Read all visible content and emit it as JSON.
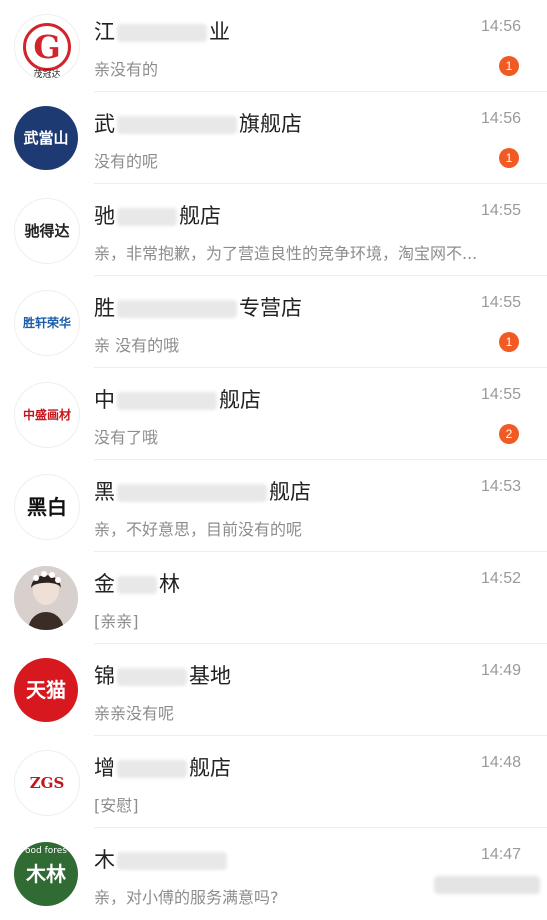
{
  "conversations": [
    {
      "title_start": "江",
      "title_end": "业",
      "subtitle": "亲没有的",
      "time": "14:56",
      "unread": "1",
      "avatar": {
        "type": "logo",
        "text": "G",
        "caption": "茂冠达",
        "bg": "#ffffff",
        "color": "#d1252b"
      }
    },
    {
      "title_start": "武",
      "title_end": "旗舰店",
      "subtitle": "没有的呢",
      "time": "14:56",
      "unread": "1",
      "avatar": {
        "type": "logo",
        "text": "武當山",
        "caption": "",
        "bg": "#1d3a73",
        "color": "#ffffff"
      }
    },
    {
      "title_start": "驰",
      "title_end": "舰店",
      "subtitle": "亲，非常抱歉，为了营造良性的竞争环境，淘宝网不...",
      "time": "14:55",
      "unread": "",
      "avatar": {
        "type": "logo",
        "text": "驰得达",
        "caption": "",
        "bg": "#ffffff",
        "color": "#222222"
      }
    },
    {
      "title_start": "胜",
      "title_end": "专营店",
      "subtitle": "亲 没有的哦",
      "time": "14:55",
      "unread": "1",
      "avatar": {
        "type": "logo",
        "text": "胜轩荣华",
        "caption": "",
        "bg": "#ffffff",
        "color": "#1b5ca8"
      }
    },
    {
      "title_start": "中",
      "title_end": "舰店",
      "subtitle": "没有了哦",
      "time": "14:55",
      "unread": "2",
      "avatar": {
        "type": "logo",
        "text": "中盛画材",
        "caption": "",
        "bg": "#ffffff",
        "color": "#c4161c"
      }
    },
    {
      "title_start": "黑",
      "title_end": "舰店",
      "subtitle": "亲，不好意思，目前没有的呢",
      "time": "14:53",
      "unread": "",
      "avatar": {
        "type": "logo",
        "text": "黑白",
        "caption": "",
        "bg": "#ffffff",
        "color": "#111111"
      }
    },
    {
      "title_start": "金",
      "title_end": "林",
      "subtitle": "[亲亲]",
      "time": "14:52",
      "unread": "",
      "avatar": {
        "type": "photo",
        "text": "",
        "caption": "",
        "bg": "#d9d2cf",
        "color": "#4a3a36"
      }
    },
    {
      "title_start": "锦",
      "title_end": "基地",
      "subtitle": "亲亲没有呢",
      "time": "14:49",
      "unread": "",
      "avatar": {
        "type": "logo",
        "text": "天猫",
        "caption": "",
        "bg": "#d7191f",
        "color": "#ffffff"
      }
    },
    {
      "title_start": "增",
      "title_end": "舰店",
      "subtitle": "[安慰]",
      "time": "14:48",
      "unread": "",
      "avatar": {
        "type": "logo",
        "text": "ZGS",
        "caption": "",
        "bg": "#ffffff",
        "color": "#c4161c"
      }
    },
    {
      "title_start": "木",
      "title_end": "",
      "subtitle": "亲，对小傅的服务满意吗?",
      "time": "14:47",
      "unread": "",
      "avatar": {
        "type": "logo",
        "text": "木林",
        "caption": "ood fores",
        "bg": "#2f6b32",
        "color": "#ffffff"
      }
    }
  ]
}
